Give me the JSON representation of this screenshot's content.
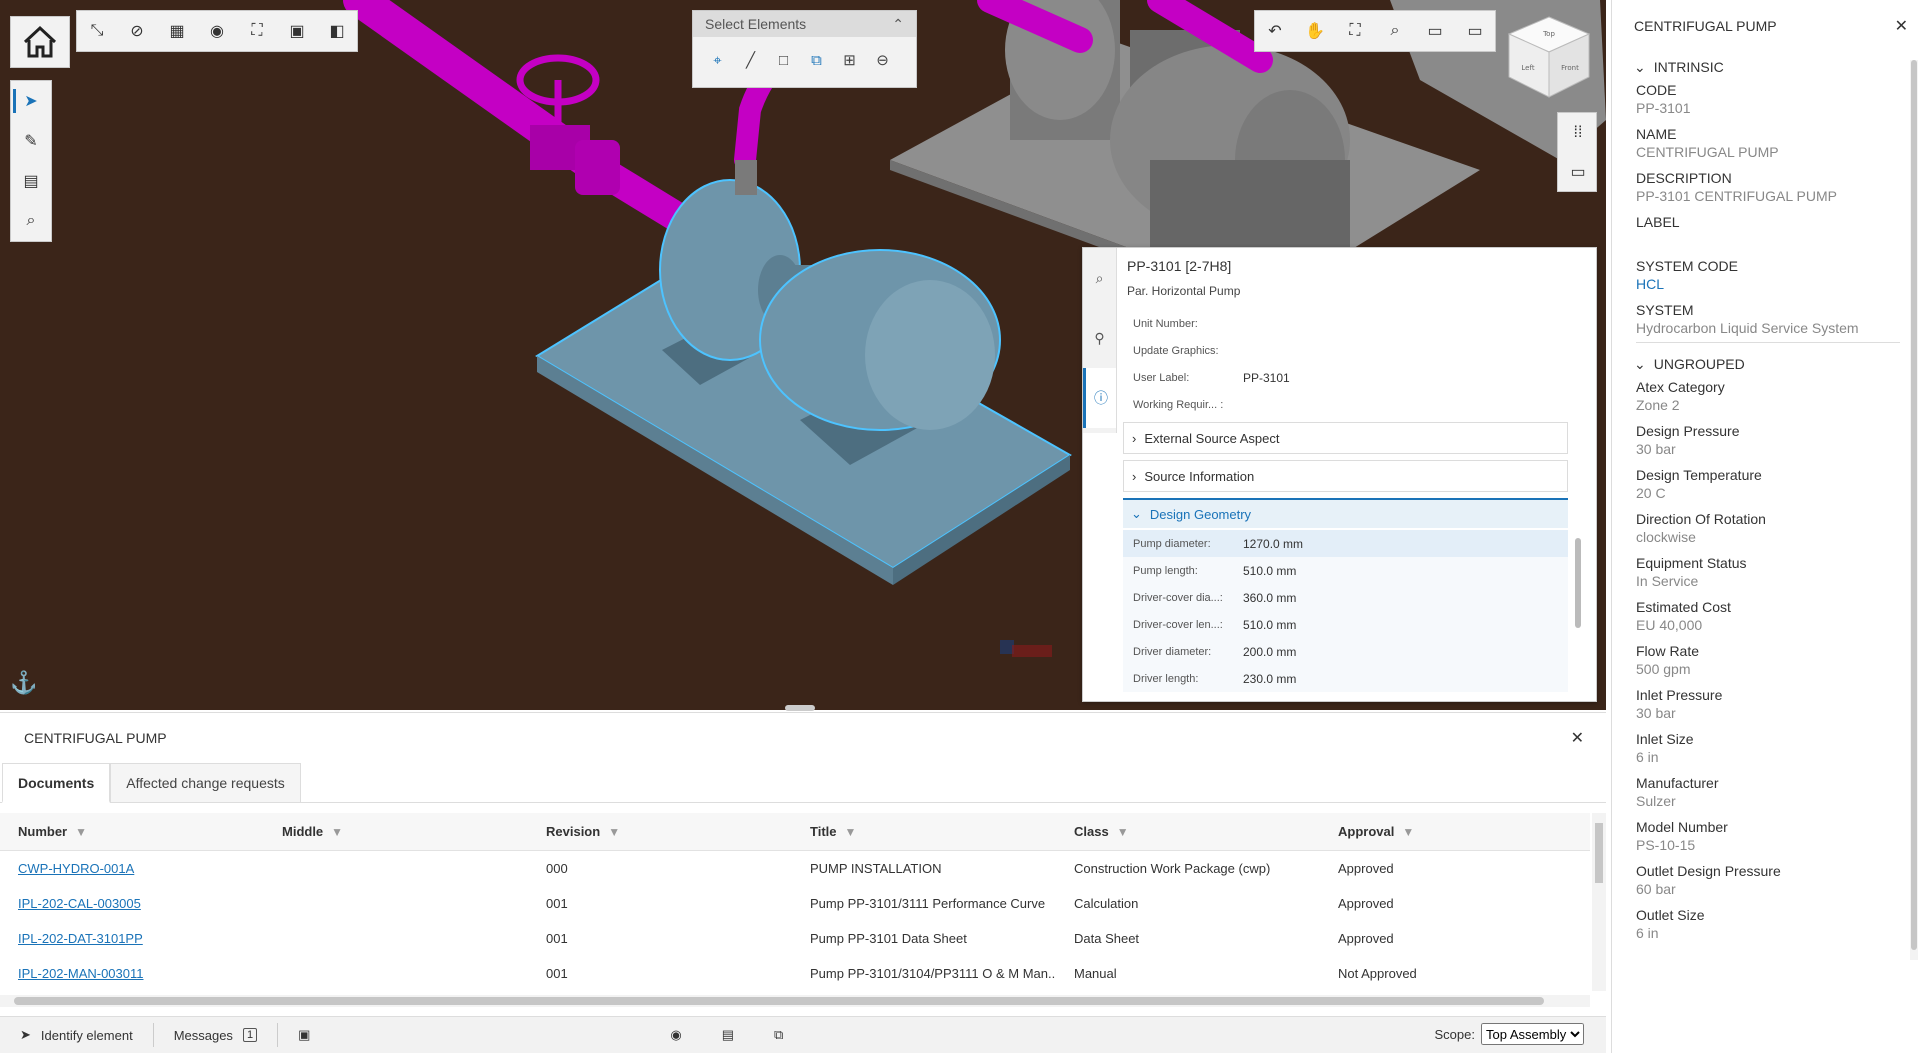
{
  "colors": {
    "accent": "#1a73b8",
    "pipe": "#c400c4",
    "pump_selected": "#6e95aa",
    "ground": "#3b2519",
    "equipment_gray": "#9a9a9a"
  },
  "toolbar": {
    "top_icons": [
      "measure-icon",
      "hide-icon",
      "grid-icon",
      "eye-icon",
      "fit-icon",
      "image-icon",
      "panel-icon"
    ],
    "left_icons": [
      "select-cursor-icon",
      "ruler-icon",
      "clipboard-icon",
      "search-icon"
    ]
  },
  "select_panel": {
    "title": "Select Elements",
    "tools": [
      "point-select-icon",
      "line-select-icon",
      "box-select-icon",
      "fence-select-icon",
      "add-icon",
      "remove-icon"
    ]
  },
  "view_toolbar": {
    "icons": [
      "undo-view-icon",
      "pan-icon",
      "frame-icon",
      "zoom-icon",
      "window-icon",
      "section-icon"
    ]
  },
  "view_cube": {
    "faces": [
      "Top",
      "Left",
      "Front"
    ]
  },
  "info_popup": {
    "title": "PP-3101 [2-7H8]",
    "subtitle": "Par. Horizontal Pump",
    "props": [
      {
        "label": "Unit Number:",
        "value": ""
      },
      {
        "label": "Update Graphics:",
        "value": ""
      },
      {
        "label": "User Label:",
        "value": "PP-3101"
      },
      {
        "label": "Working Requir... :",
        "value": ""
      }
    ],
    "sections": [
      "External Source Aspect",
      "Source Information"
    ],
    "open_section": "Design Geometry",
    "design_geometry": [
      {
        "label": "Pump diameter:",
        "value": "1270.0 mm"
      },
      {
        "label": "Pump length:",
        "value": "510.0 mm"
      },
      {
        "label": "Driver-cover dia...:",
        "value": "360.0 mm"
      },
      {
        "label": "Driver-cover len...:",
        "value": "510.0 mm"
      },
      {
        "label": "Driver diameter:",
        "value": "200.0 mm"
      },
      {
        "label": "Driver length:",
        "value": "230.0 mm"
      }
    ]
  },
  "props_panel": {
    "title": "CENTRIFUGAL PUMP",
    "groups": [
      {
        "name": "INTRINSIC",
        "items": [
          {
            "key": "CODE",
            "value": "PP-3101"
          },
          {
            "key": "NAME",
            "value": "CENTRIFUGAL PUMP"
          },
          {
            "key": "DESCRIPTION",
            "value": "PP-3101 CENTRIFUGAL PUMP"
          },
          {
            "key": "LABEL",
            "value": ""
          },
          {
            "key": "SYSTEM CODE",
            "value": "HCL",
            "link": true
          },
          {
            "key": "SYSTEM",
            "value": "Hydrocarbon Liquid Service System"
          }
        ]
      },
      {
        "name": "UNGROUPED",
        "items": [
          {
            "key": "Atex Category",
            "value": "Zone 2"
          },
          {
            "key": "Design Pressure",
            "value": "30 bar"
          },
          {
            "key": "Design Temperature",
            "value": "20 C"
          },
          {
            "key": "Direction Of Rotation",
            "value": "clockwise"
          },
          {
            "key": "Equipment Status",
            "value": "In Service"
          },
          {
            "key": "Estimated Cost",
            "value": "EU 40,000"
          },
          {
            "key": "Flow Rate",
            "value": "500 gpm"
          },
          {
            "key": "Inlet Pressure",
            "value": "30 bar"
          },
          {
            "key": "Inlet Size",
            "value": "6 in"
          },
          {
            "key": "Manufacturer",
            "value": "Sulzer"
          },
          {
            "key": "Model Number",
            "value": "PS-10-15"
          },
          {
            "key": "Outlet Design Pressure",
            "value": "60 bar"
          },
          {
            "key": "Outlet Size",
            "value": "6 in"
          }
        ]
      }
    ]
  },
  "bottom_panel": {
    "title": "CENTRIFUGAL PUMP",
    "tabs": [
      "Documents",
      "Affected change requests"
    ],
    "columns": [
      "Number",
      "Middle",
      "Revision",
      "Title",
      "Class",
      "Approval"
    ],
    "rows": [
      [
        "CWP-HYDRO-001A",
        "",
        "000",
        "PUMP INSTALLATION",
        "Construction Work Package (cwp)",
        "Approved"
      ],
      [
        "IPL-202-CAL-003005",
        "",
        "001",
        "Pump PP-3101/3111 Performance Curve",
        "Calculation",
        "Approved"
      ],
      [
        "IPL-202-DAT-3101PP",
        "",
        "001",
        "Pump PP-3101 Data Sheet",
        "Data Sheet",
        "Approved"
      ],
      [
        "IPL-202-MAN-003011",
        "",
        "001",
        "Pump PP-3101/3104/PP3111 O & M Man...",
        "Manual",
        "Not Approved"
      ]
    ]
  },
  "status_bar": {
    "identify": "Identify element",
    "messages": "Messages",
    "messages_count": "1",
    "scope_label": "Scope:",
    "scope_value": "Top Assembly"
  }
}
